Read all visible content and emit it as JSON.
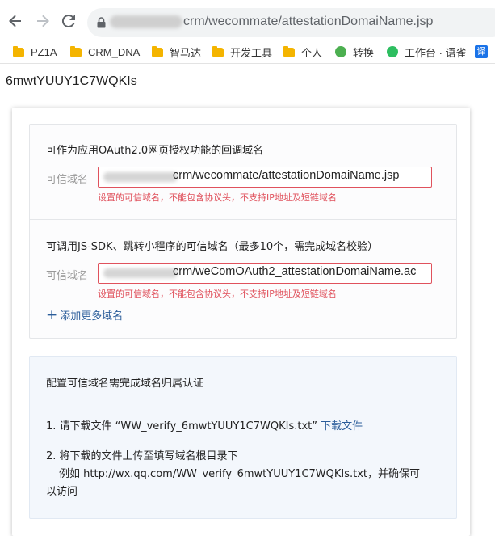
{
  "browser": {
    "url_text": "crm/wecommate/attestationDomaiName.jsp",
    "bookmarks": [
      {
        "label": "PZ1A"
      },
      {
        "label": "CRM_DNA"
      },
      {
        "label": "智马达"
      },
      {
        "label": "开发工具"
      },
      {
        "label": "个人"
      },
      {
        "label": "转换"
      },
      {
        "label": "工作台 · 语雀"
      },
      {
        "label": "译"
      }
    ]
  },
  "page": {
    "corp_id": "6mwtYUUY1C7WQKIs",
    "oauth": {
      "title": "可作为应用OAuth2.0网页授权功能的回调域名",
      "label": "可信域名",
      "value": "crm/wecommate/attestationDomaiName.jsp",
      "error": "设置的可信域名，不能包含协议头，不支持IP地址及短链域名"
    },
    "jssdk": {
      "title": "可调用JS-SDK、跳转小程序的可信域名（最多10个，需完成域名校验）",
      "label": "可信域名",
      "value": "crm/weComOAuth2_attestationDomaiName.ac",
      "error": "设置的可信域名，不能包含协议头，不支持IP地址及短链域名",
      "add_more": "添加更多域名"
    },
    "verify": {
      "title": "配置可信域名需完成域名归属认证",
      "step1_text": "1. 请下载文件 “WW_verify_6mwtYUUY1C7WQKIs.txt”",
      "step1_link": "下载文件",
      "step2_line1": "2. 将下载的文件上传至填写域名根目录下",
      "step2_line2": "例如 http://wx.qq.com/WW_verify_6mwtYUUY1C7WQKIs.txt，并确保可",
      "step2_line3": "以访问"
    }
  }
}
